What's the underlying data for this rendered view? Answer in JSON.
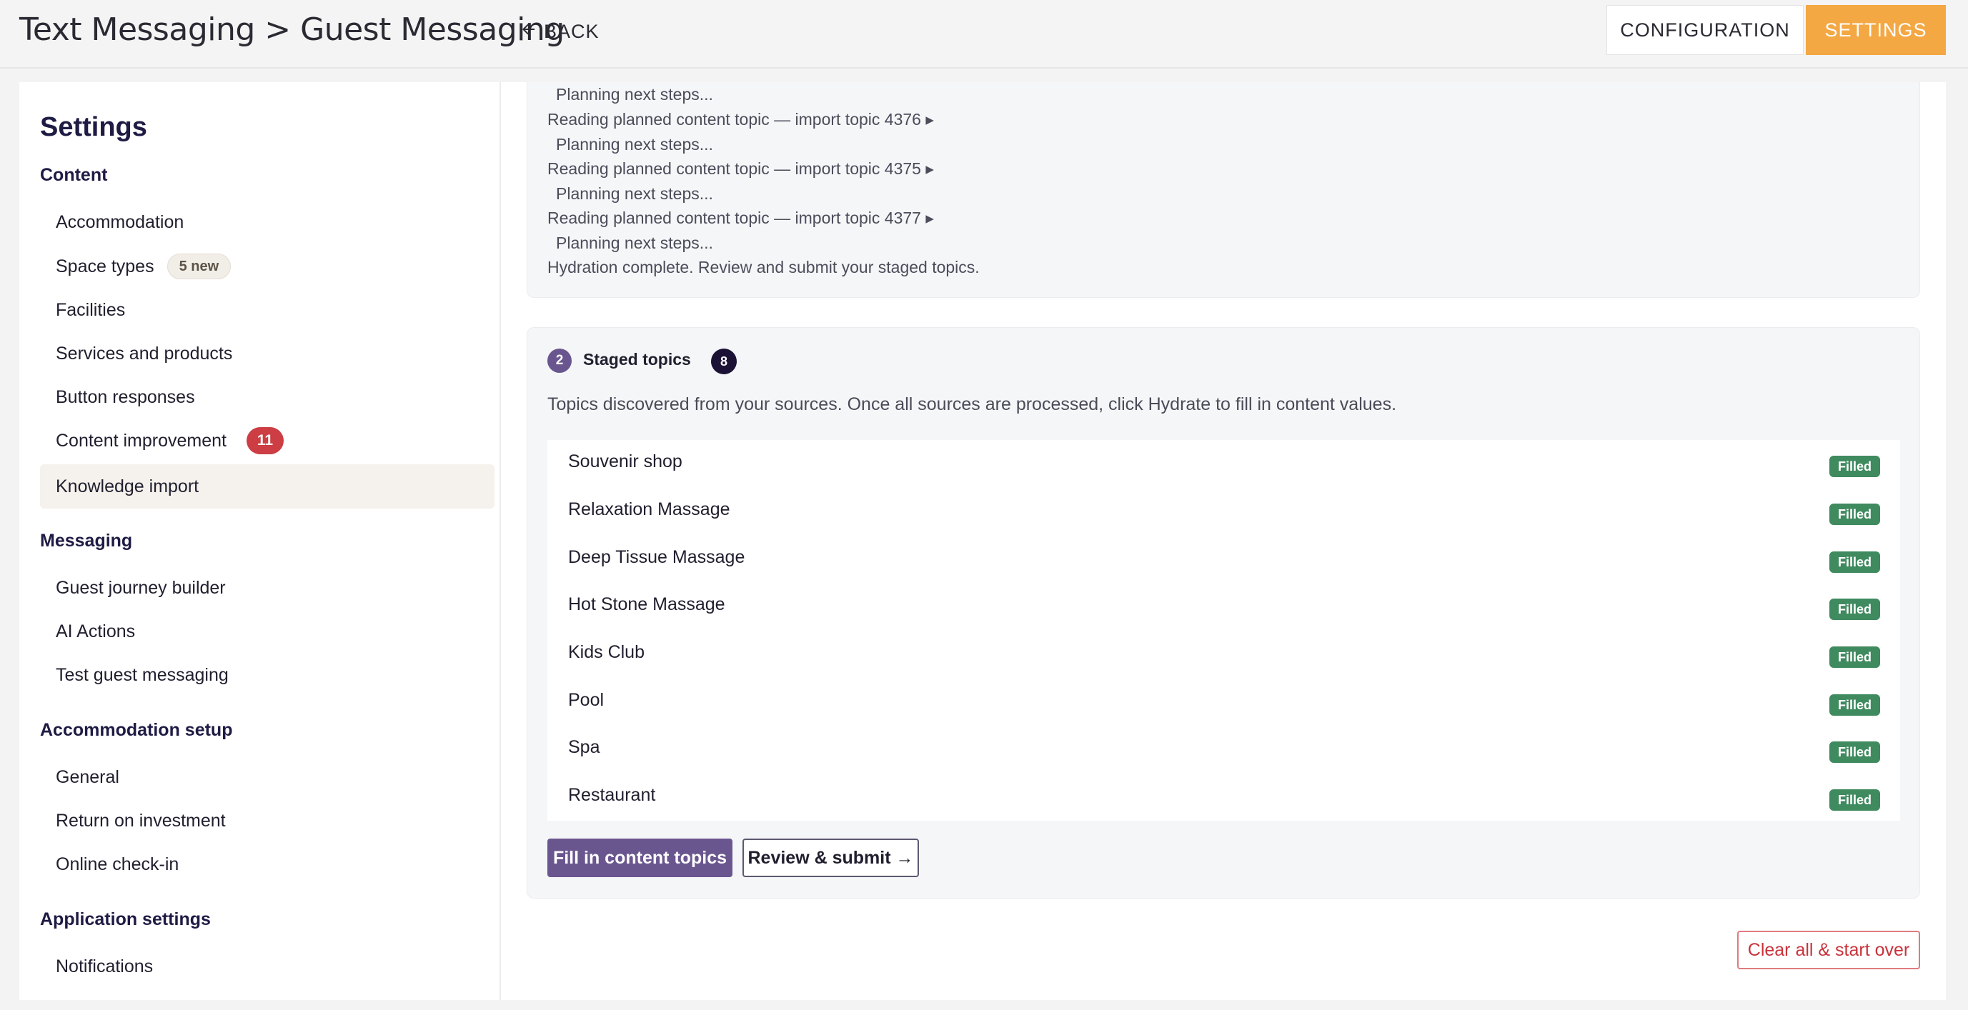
{
  "header": {
    "title": "Text Messaging > Guest Messaging",
    "back_label": "BACK",
    "configuration_label": "CONFIGURATION",
    "settings_label": "SETTINGS"
  },
  "sidebar": {
    "title": "Settings",
    "sections": [
      {
        "heading": "Content",
        "items": [
          {
            "label": "Accommodation"
          },
          {
            "label": "Space types",
            "badge": "5 new"
          },
          {
            "label": "Facilities"
          },
          {
            "label": "Services and products"
          },
          {
            "label": "Button responses"
          },
          {
            "label": "Content improvement",
            "count": "11"
          },
          {
            "label": "Knowledge import",
            "active": true
          }
        ]
      },
      {
        "heading": "Messaging",
        "items": [
          {
            "label": "Guest journey builder"
          },
          {
            "label": "AI Actions"
          },
          {
            "label": "Test guest messaging"
          }
        ]
      },
      {
        "heading": "Accommodation setup",
        "items": [
          {
            "label": "General"
          },
          {
            "label": "Return on investment"
          },
          {
            "label": "Online check-in"
          }
        ]
      },
      {
        "heading": "Application settings",
        "items": [
          {
            "label": "Notifications"
          }
        ]
      }
    ]
  },
  "log": {
    "lines": [
      "Planning next steps...",
      "Reading planned content topic — import topic 4376 ▸",
      "Planning next steps...",
      "Reading planned content topic — import topic 4375 ▸",
      "Planning next steps...",
      "Reading planned content topic — import topic 4377 ▸",
      "Planning next steps...",
      "Hydration complete. Review and submit your staged topics."
    ]
  },
  "staged": {
    "step": "2",
    "title": "Staged topics",
    "count": "8",
    "description": "Topics discovered from your sources. Once all sources are processed, click Hydrate to fill in content values.",
    "topics": [
      {
        "name": "Souvenir shop",
        "status": "Filled"
      },
      {
        "name": "Relaxation Massage",
        "status": "Filled"
      },
      {
        "name": "Deep Tissue Massage",
        "status": "Filled"
      },
      {
        "name": "Hot Stone Massage",
        "status": "Filled"
      },
      {
        "name": "Kids Club",
        "status": "Filled"
      },
      {
        "name": "Pool",
        "status": "Filled"
      },
      {
        "name": "Spa",
        "status": "Filled"
      },
      {
        "name": "Restaurant",
        "status": "Filled"
      }
    ],
    "fill_button": "Fill in content topics",
    "review_button": "Review & submit →"
  },
  "clear_button": "Clear all & start over",
  "colors": {
    "accent_orange": "#f4a844",
    "primary_purple": "#6a568f",
    "navy": "#1e1b44",
    "filled_green": "#3f8a5f",
    "danger_red": "#cc3d44"
  }
}
